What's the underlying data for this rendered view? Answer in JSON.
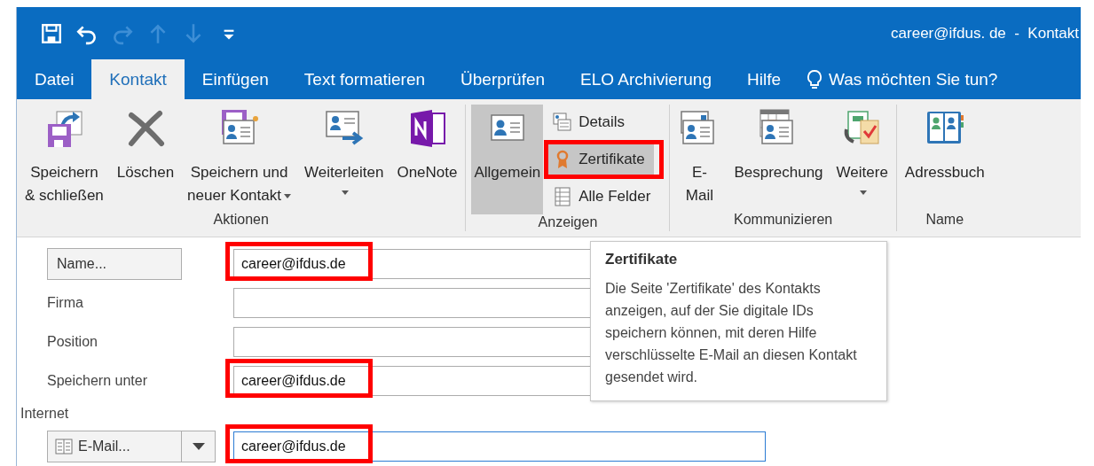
{
  "window": {
    "title": "career@ifdus. de  -  Kontakt"
  },
  "quick_access": [
    {
      "kind": "save",
      "disabled": false
    },
    {
      "kind": "undo",
      "disabled": false
    },
    {
      "kind": "redo",
      "disabled": true
    },
    {
      "kind": "up",
      "disabled": true
    },
    {
      "kind": "down",
      "disabled": true
    },
    {
      "kind": "customize",
      "disabled": false
    }
  ],
  "tabs": [
    {
      "label": "Datei",
      "selected": false
    },
    {
      "label": "Kontakt",
      "selected": true
    },
    {
      "label": "Einfügen",
      "selected": false
    },
    {
      "label": "Text formatieren",
      "selected": false
    },
    {
      "label": "Überprüfen",
      "selected": false
    },
    {
      "label": "ELO Archivierung",
      "selected": false
    },
    {
      "label": "Hilfe",
      "selected": false
    }
  ],
  "tell_me": {
    "placeholder": "Was möchten Sie tun?"
  },
  "ribbon": {
    "groups": [
      {
        "label": "Aktionen",
        "buttons": [
          {
            "kind": "large",
            "label": "Speichern\n& schließen",
            "dropdown": false,
            "selected": false,
            "highlighted": false
          },
          {
            "kind": "large",
            "label": "Löschen",
            "dropdown": false,
            "selected": false,
            "highlighted": false
          },
          {
            "kind": "large",
            "label": "Speichern und\nneuer Kontakt",
            "dropdown": true,
            "selected": false,
            "highlighted": false
          },
          {
            "kind": "large",
            "label": "Weiterleiten",
            "dropdown": true,
            "selected": false,
            "highlighted": false
          },
          {
            "kind": "large",
            "label": "OneNote",
            "dropdown": false,
            "selected": false,
            "highlighted": false
          }
        ]
      },
      {
        "label": "Anzeigen",
        "buttons": [
          {
            "kind": "large",
            "label": "Allgemein",
            "dropdown": false,
            "selected": true,
            "highlighted": false
          },
          {
            "kind": "small",
            "label": "Details",
            "dropdown": false,
            "selected": false,
            "highlighted": false
          },
          {
            "kind": "small",
            "label": "Zertifikate",
            "dropdown": false,
            "selected": false,
            "highlighted": true
          },
          {
            "kind": "small",
            "label": "Alle Felder",
            "dropdown": false,
            "selected": false,
            "highlighted": false
          }
        ]
      },
      {
        "label": "Kommunizieren",
        "buttons": [
          {
            "kind": "large",
            "label": "E-\nMail",
            "dropdown": false,
            "selected": false,
            "highlighted": false
          },
          {
            "kind": "large",
            "label": "Besprechung",
            "dropdown": false,
            "selected": false,
            "highlighted": false
          },
          {
            "kind": "large",
            "label": "Weitere",
            "dropdown": true,
            "selected": false,
            "highlighted": false
          }
        ]
      },
      {
        "label": "Name",
        "buttons": [
          {
            "kind": "large",
            "label": "Adressbuch",
            "dropdown": false,
            "selected": false,
            "highlighted": false
          }
        ]
      }
    ]
  },
  "tooltip": {
    "title": "Zertifikate",
    "text": "Die Seite 'Zertifikate' des Kontakts anzeigen, auf der Sie digitale IDs speichern können, mit deren Hilfe verschlüsselte E-Mail an diesen Kontakt gesendet wird."
  },
  "form": {
    "fields": [
      {
        "kind": "button",
        "label": "Name...",
        "value": "career@ifdus.de",
        "highlighted": true
      },
      {
        "kind": "label",
        "label": "Firma",
        "highlighted": false
      },
      {
        "kind": "label",
        "label": "Position",
        "highlighted": false
      },
      {
        "kind": "label",
        "label": "Speichern unter",
        "value": "career@ifdus.de",
        "highlighted": true
      }
    ],
    "section": "Internet",
    "email": {
      "label": "E-Mail...",
      "value": "career@ifdus.de",
      "focused": true,
      "highlighted": true
    }
  }
}
